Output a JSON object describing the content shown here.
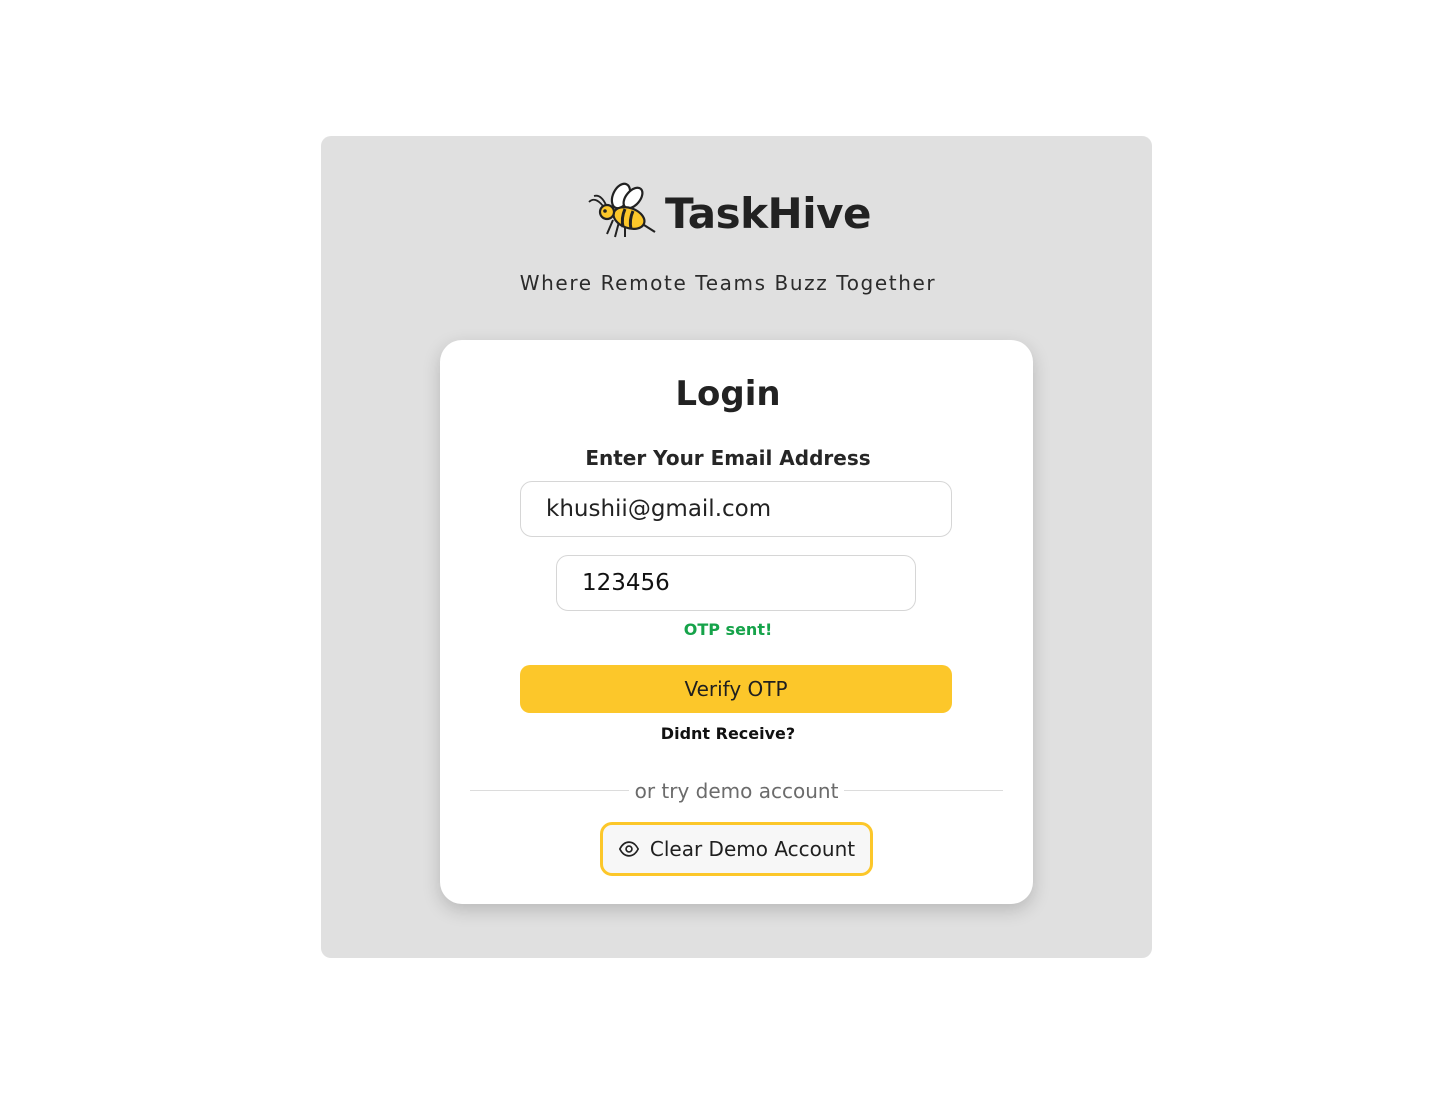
{
  "brand": {
    "logo_icon": "bee-icon",
    "name": "TaskHive",
    "tagline": "Where Remote Teams Buzz Together"
  },
  "login": {
    "title": "Login",
    "email_label": "Enter Your Email Address",
    "email_value": "khushii@gmail.com",
    "otp_value": "123456",
    "otp_status": "OTP sent!",
    "verify_button": "Verify OTP",
    "resend_link": "Didnt Receive?",
    "divider_text": "or try demo account",
    "demo_button": {
      "icon": "eye-icon",
      "label": "Clear Demo Account"
    }
  },
  "colors": {
    "panel_bg": "#e0e0e0",
    "accent_yellow": "#fcc72a",
    "success_green": "#16a34a"
  }
}
